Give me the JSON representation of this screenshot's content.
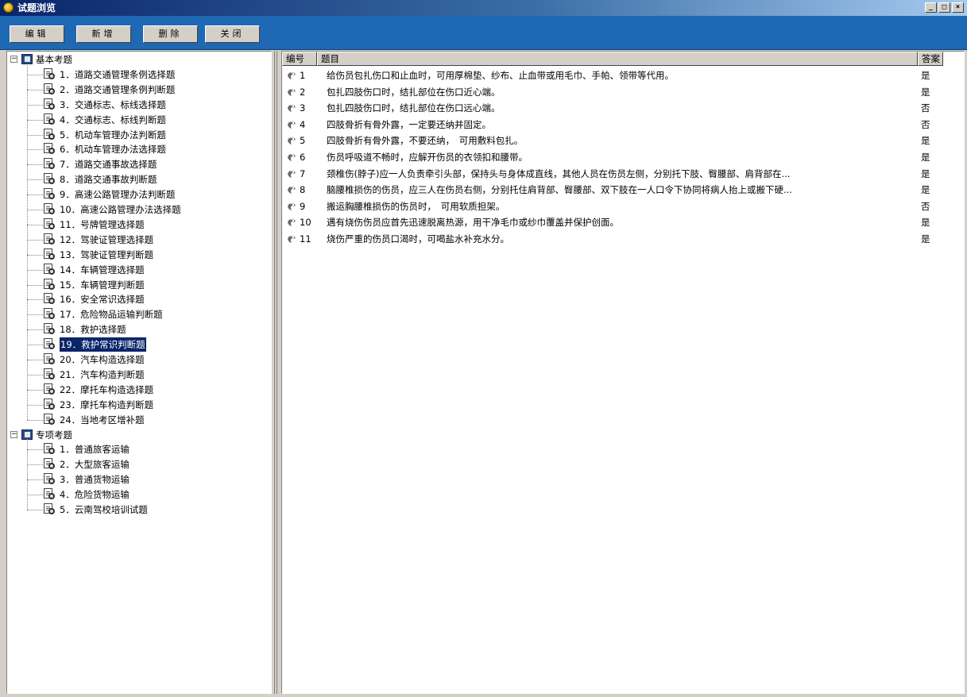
{
  "window": {
    "title": "试题浏览",
    "controls": [
      "_",
      "□",
      "×"
    ]
  },
  "toolbar": {
    "buttons": [
      {
        "label": "编辑"
      },
      {
        "label": "新增"
      },
      {
        "label": "删除"
      },
      {
        "label": "关闭"
      }
    ]
  },
  "tree": {
    "groups": [
      {
        "label": "基本考题",
        "expander": "−",
        "items": [
          "1．道路交通管理条例选择题",
          "2．道路交通管理条例判断题",
          "3．交通标志、标线选择题",
          "4．交通标志、标线判断题",
          "5．机动车管理办法判断题",
          "6．机动车管理办法选择题",
          "7．道路交通事故选择题",
          "8．道路交通事故判断题",
          "9．高速公路管理办法判断题",
          "10．高速公路管理办法选择题",
          "11．号牌管理选择题",
          "12．驾驶证管理选择题",
          "13．驾驶证管理判断题",
          "14．车辆管理选择题",
          "15．车辆管理判断题",
          "16．安全常识选择题",
          "17．危险物品运输判断题",
          "18．救护选择题",
          "19．救护常识判断题",
          "20．汽车构造选择题",
          "21．汽车构造判断题",
          "22．摩托车构造选择题",
          "23．摩托车构造判断题",
          "24．当地考区增补题"
        ],
        "selected_index": 18
      },
      {
        "label": "专项考题",
        "expander": "−",
        "items": [
          "1．普通旅客运输",
          "2．大型旅客运输",
          "3．普通货物运输",
          "4．危险货物运输",
          "5．云南驾校培训试题"
        ]
      }
    ]
  },
  "list": {
    "columns": [
      "编号",
      "题目",
      "答案"
    ],
    "rows": [
      {
        "id": "1",
        "question": "给伤员包扎伤口和止血时，可用厚棉垫、纱布、止血带或用毛巾、手帕、领带等代用。",
        "answer": "是"
      },
      {
        "id": "2",
        "question": "包扎四肢伤口时，结扎部位在伤口近心端。",
        "answer": "是"
      },
      {
        "id": "3",
        "question": "包扎四肢伤口时，结扎部位在伤口远心端。",
        "answer": "否"
      },
      {
        "id": "4",
        "question": "四肢骨折有骨外露，一定要还纳并固定。",
        "answer": "否"
      },
      {
        "id": "5",
        "question": "四肢骨折有骨外露，不要还纳，　可用敷料包扎。",
        "answer": "是"
      },
      {
        "id": "6",
        "question": "伤员呼吸道不畅时，应解开伤员的衣领扣和腰带。",
        "answer": "是"
      },
      {
        "id": "7",
        "question": "颈椎伤(脖子)应一人负责牵引头部，保持头与身体成直线，其他人员在伤员左侧，分别托下肢、臀腰部、肩背部在...",
        "answer": "是"
      },
      {
        "id": "8",
        "question": "脑腰椎损伤的伤员，应三人在伤员右侧，分别托住肩背部、臀腰部、双下肢在一人口令下协同将病人抬上或搬下硬...",
        "answer": "是"
      },
      {
        "id": "9",
        "question": "搬运胸腰椎损伤的伤员时，　可用软质担架。",
        "answer": "否"
      },
      {
        "id": "10",
        "question": "遇有烧伤伤员应首先迅速脱离热源，用干净毛巾或纱巾覆盖并保护创面。",
        "answer": "是"
      },
      {
        "id": "11",
        "question": "烧伤严重的伤员口渴时，可喝盐水补充水分。",
        "answer": "是"
      }
    ]
  }
}
